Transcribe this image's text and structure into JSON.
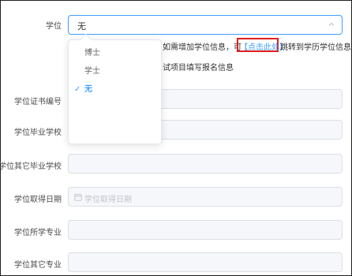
{
  "degree_field": {
    "label": "学位",
    "value": "无"
  },
  "degree_dropdown": {
    "options": [
      {
        "label": "博士"
      },
      {
        "label": "学士"
      },
      {
        "label": "无",
        "selected": true
      }
    ]
  },
  "hint": {
    "text_before": "如需增加学位信息，可",
    "link": "【点击此处】",
    "text_after": "跳转到学历学位信息",
    "line2": "试项目填写报名信息"
  },
  "fields": {
    "cert_number_label": "学位证书编号",
    "grad_school_label": "学位毕业学校",
    "other_school_label": "学位其它毕业学校",
    "date_label": "学位取得日期",
    "date_placeholder": "学位取得日期",
    "major_label": "学位所学专业",
    "other_major_label": "学位其它专业"
  },
  "colors": {
    "accent": "#409eff",
    "highlight_border": "#e21f1f",
    "disabled_bg": "#f5f7fa"
  }
}
